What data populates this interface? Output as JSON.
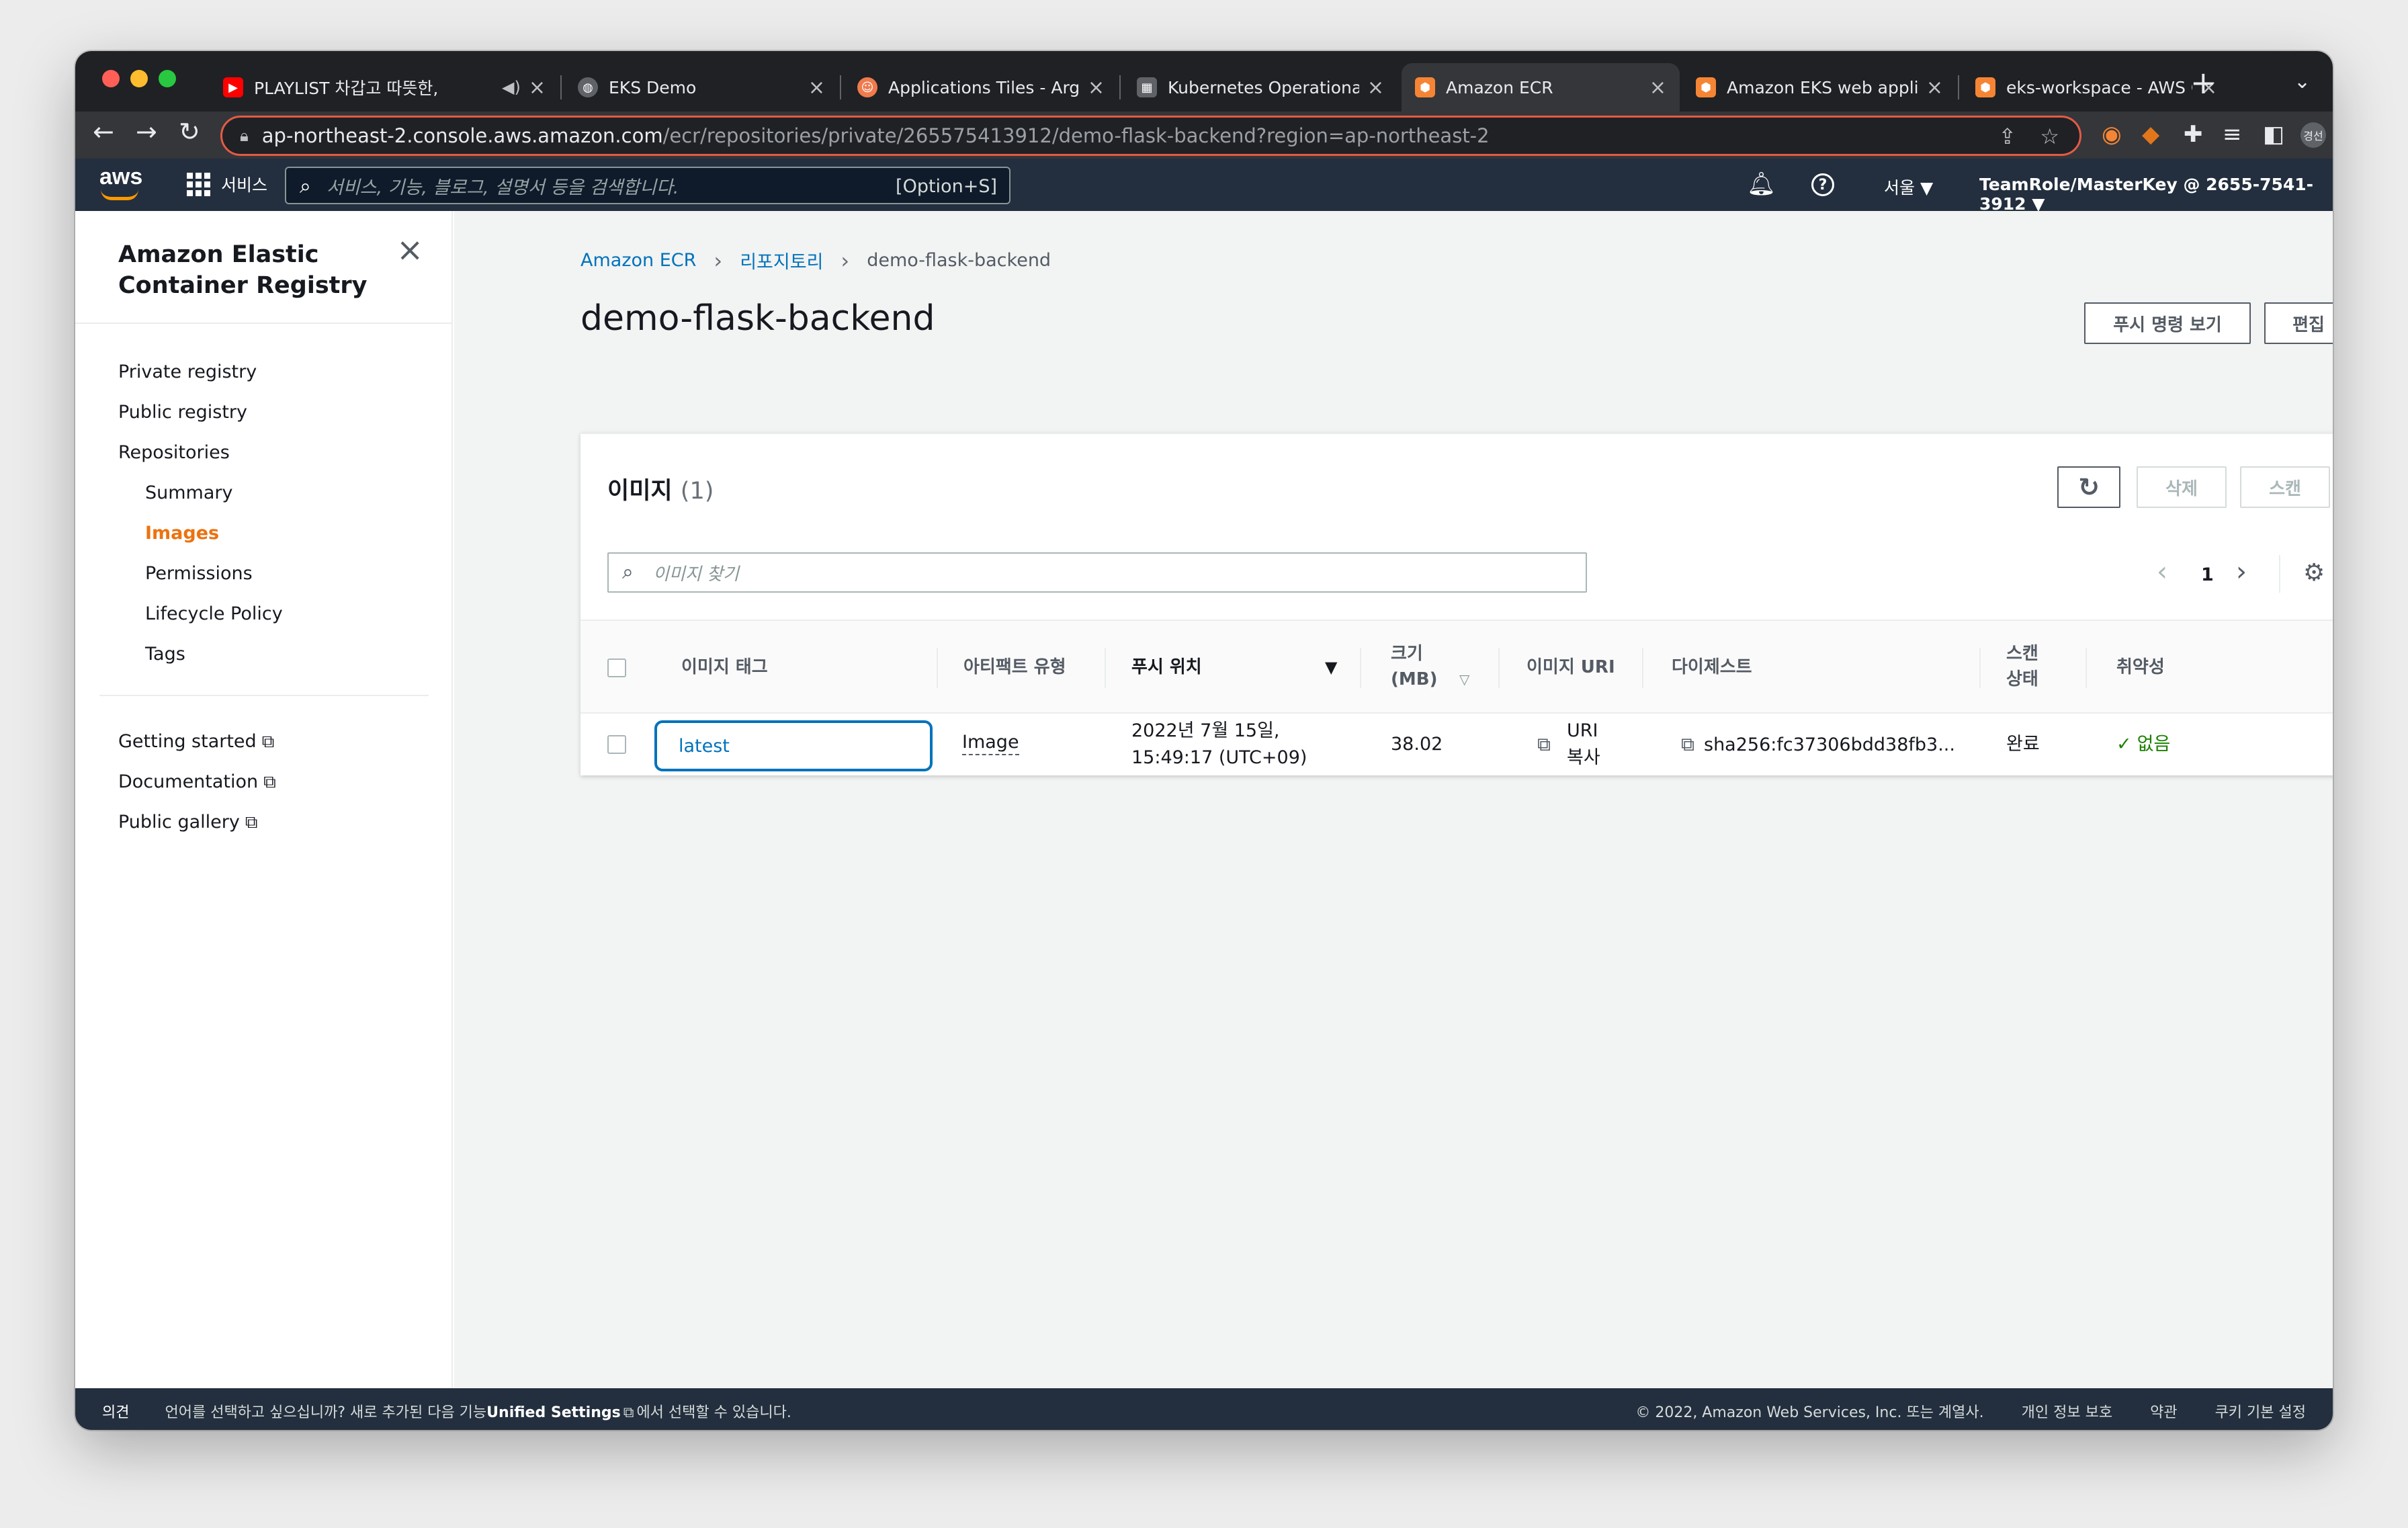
{
  "browser": {
    "tabs": [
      {
        "title": "PLAYLIST 차갑고 따뜻한,",
        "favicon": "youtube-icon",
        "color": "#ff0000",
        "muted_icon": "speaker-icon"
      },
      {
        "title": "EKS Demo",
        "favicon": "globe-icon",
        "color": "#9aa0a6"
      },
      {
        "title": "Applications Tiles - Argo",
        "favicon": "argo-icon",
        "color": "#ef7b4d"
      },
      {
        "title": "Kubernetes Operational V",
        "favicon": "grafana-icon",
        "color": "#9aa0a6"
      },
      {
        "title": "Amazon ECR",
        "favicon": "aws-box-icon",
        "color": "#f58534",
        "active": true
      },
      {
        "title": "Amazon EKS web applica",
        "favicon": "aws-box-icon",
        "color": "#f58534"
      },
      {
        "title": "eks-workspace - AWS Clo",
        "favicon": "aws-box-icon",
        "color": "#f58534"
      }
    ],
    "url_host": "ap-northeast-2.console.aws.amazon.com",
    "url_path": "/ecr/repositories/private/265575413912/demo-flask-backend?region=ap-northeast-2",
    "profile_label": "경선"
  },
  "aws_header": {
    "logo": "aws",
    "services_label": "서비스",
    "search_placeholder": "서비스, 기능, 블로그, 설명서 등을 검색합니다.",
    "search_shortcut": "[Option+S]",
    "region": "서울 ▼",
    "account": "TeamRole/MasterKey @ 2655-7541-3912 ▼"
  },
  "sidebar": {
    "title_line1": "Amazon Elastic",
    "title_line2": "Container Registry",
    "items": [
      {
        "label": "Private registry"
      },
      {
        "label": "Public registry"
      },
      {
        "label": "Repositories"
      },
      {
        "label": "Summary"
      },
      {
        "label": "Images",
        "active": true
      },
      {
        "label": "Permissions"
      },
      {
        "label": "Lifecycle Policy"
      },
      {
        "label": "Tags"
      }
    ],
    "links": [
      {
        "label": "Getting started"
      },
      {
        "label": "Documentation"
      },
      {
        "label": "Public gallery"
      }
    ]
  },
  "main": {
    "breadcrumb": [
      "Amazon ECR",
      "리포지토리",
      "demo-flask-backend"
    ],
    "title": "demo-flask-backend",
    "push_commands_label": "푸시 명령 보기",
    "edit_label": "편집",
    "panel": {
      "title": "이미지",
      "count": "(1)",
      "delete_label": "삭제",
      "scan_label": "스캔",
      "search_placeholder": "이미지 찾기",
      "page": "1",
      "columns": {
        "tag": "이미지 태그",
        "artifact": "아티팩트 유형",
        "pushed": "푸시 위치",
        "size_line1": "크기",
        "size_line2": "(MB)",
        "uri": "이미지 URI",
        "digest": "다이제스트",
        "scan_line1": "스캔",
        "scan_line2": "상태",
        "vuln": "취약성"
      },
      "rows": [
        {
          "tag": "latest",
          "artifact": "Image",
          "pushed_line1": "2022년 7월 15일,",
          "pushed_line2": "15:49:17 (UTC+09)",
          "size": "38.02",
          "uri_line1": "URI",
          "uri_line2": "복사",
          "digest": "sha256:fc37306bdd38fb3...",
          "scan_status": "완료",
          "vulnerability": "없음"
        }
      ]
    }
  },
  "footer": {
    "feedback": "의견",
    "lang_prefix": "언어를 선택하고 싶으십니까? 새로 추가된 다음 기능",
    "lang_link": "Unified Settings",
    "lang_suffix": "에서 선택할 수 있습니다.",
    "copyright": "© 2022, Amazon Web Services, Inc. 또는 계열사.",
    "privacy": "개인 정보 보호",
    "terms": "약관",
    "cookie": "쿠키 기본 설정"
  },
  "colors": {
    "aws_orange": "#ec7211",
    "link_blue": "#0073bb",
    "success_green": "#1d8102",
    "header_navy": "#232f3e"
  }
}
